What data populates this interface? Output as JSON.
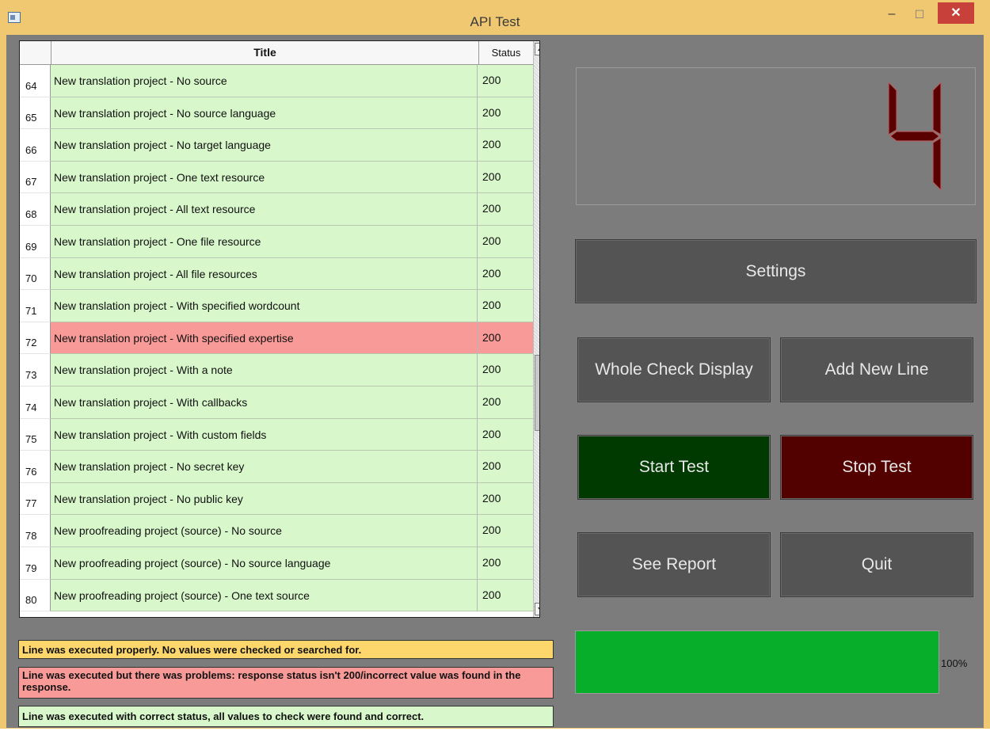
{
  "window": {
    "title": "API Test",
    "minimize_glyph": "–",
    "maximize_glyph": "☐",
    "close_glyph": "✕",
    "icon": "app-window-icon"
  },
  "table": {
    "headers": {
      "number": "",
      "title": "Title",
      "status": "Status"
    },
    "rows": [
      {
        "num": "64",
        "title": "New translation project - No source",
        "status": "200",
        "state": "ok"
      },
      {
        "num": "65",
        "title": "New translation project - No source language",
        "status": "200",
        "state": "ok"
      },
      {
        "num": "66",
        "title": "New translation project - No target language",
        "status": "200",
        "state": "ok"
      },
      {
        "num": "67",
        "title": "New translation project - One text resource",
        "status": "200",
        "state": "ok"
      },
      {
        "num": "68",
        "title": "New translation project - All text resource",
        "status": "200",
        "state": "ok"
      },
      {
        "num": "69",
        "title": "New translation project - One file resource",
        "status": "200",
        "state": "ok"
      },
      {
        "num": "70",
        "title": "New translation project - All file resources",
        "status": "200",
        "state": "ok"
      },
      {
        "num": "71",
        "title": "New translation project - With specified wordcount",
        "status": "200",
        "state": "ok"
      },
      {
        "num": "72",
        "title": "New translation project - With specified expertise",
        "status": "200",
        "state": "error"
      },
      {
        "num": "73",
        "title": "New translation project - With a note",
        "status": "200",
        "state": "ok"
      },
      {
        "num": "74",
        "title": "New translation project - With callbacks",
        "status": "200",
        "state": "ok"
      },
      {
        "num": "75",
        "title": "New translation project - With custom fields",
        "status": "200",
        "state": "ok"
      },
      {
        "num": "76",
        "title": "New translation project - No secret key",
        "status": "200",
        "state": "ok"
      },
      {
        "num": "77",
        "title": "New translation project - No public key",
        "status": "200",
        "state": "ok"
      },
      {
        "num": "78",
        "title": "New proofreading project (source) - No source",
        "status": "200",
        "state": "ok"
      },
      {
        "num": "79",
        "title": "New proofreading project (source) - No source language",
        "status": "200",
        "state": "ok"
      },
      {
        "num": "80",
        "title": "New proofreading project (source) - One text source",
        "status": "200",
        "state": "ok"
      }
    ]
  },
  "legend": {
    "yellow": "Line was executed properly. No values were checked or searched for.",
    "red": "Line was executed but there was problems: response status isn't 200/incorrect value was found in the response.",
    "green": "Line was executed with correct status, all values to check were found and correct."
  },
  "display": {
    "digit": "4"
  },
  "buttons": {
    "settings": "Settings",
    "whole_check_display": "Whole Check Display",
    "add_new_line": "Add New Line",
    "start_test": "Start Test",
    "stop_test": "Stop Test",
    "see_report": "See Report",
    "quit": "Quit"
  },
  "progress": {
    "value": 100,
    "label": "100%"
  },
  "colors": {
    "row_ok": "#d8f7cb",
    "row_error": "#f89a97",
    "legend_yellow": "#fdd76b",
    "start_button": "#003a00",
    "stop_button": "#520000",
    "progress_fill": "#06ae2a",
    "digit_segment": "#5a0000"
  }
}
